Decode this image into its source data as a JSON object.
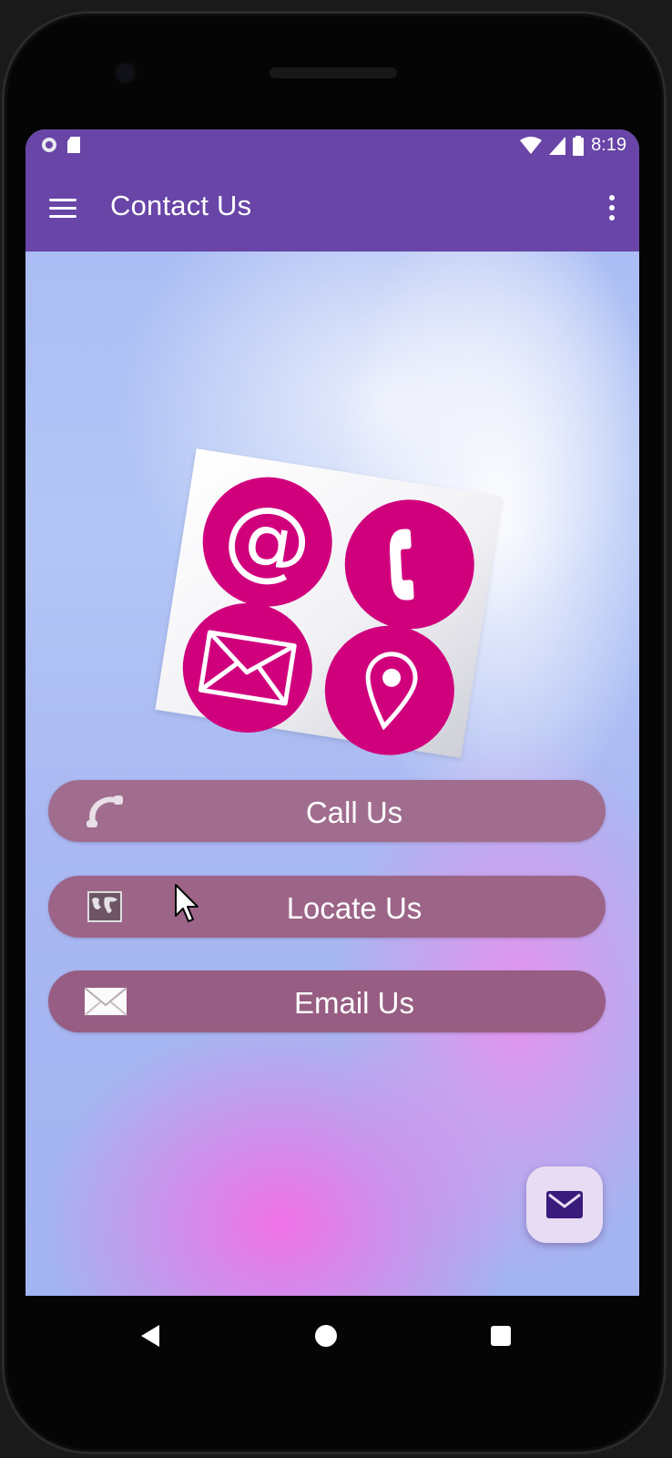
{
  "status_bar": {
    "time": "8:19"
  },
  "app_bar": {
    "title": "Contact Us"
  },
  "buttons": {
    "call": {
      "label": "Call Us",
      "icon": "phone-handset-icon"
    },
    "locate": {
      "label": "Locate Us",
      "icon": "world-map-icon"
    },
    "email": {
      "label": "Email Us",
      "icon": "envelope-icon"
    }
  },
  "logo": {
    "icons": [
      "at-sign-icon",
      "phone-icon",
      "envelope-icon",
      "map-pin-icon"
    ],
    "at_symbol": "@",
    "accent_color": "#d0007d"
  },
  "fab": {
    "icon": "email-icon"
  },
  "colors": {
    "app_bar": "#6845a7",
    "button": "#a06d8f",
    "fab": "#e8dcf5",
    "fab_icon": "#3a1a7a"
  }
}
